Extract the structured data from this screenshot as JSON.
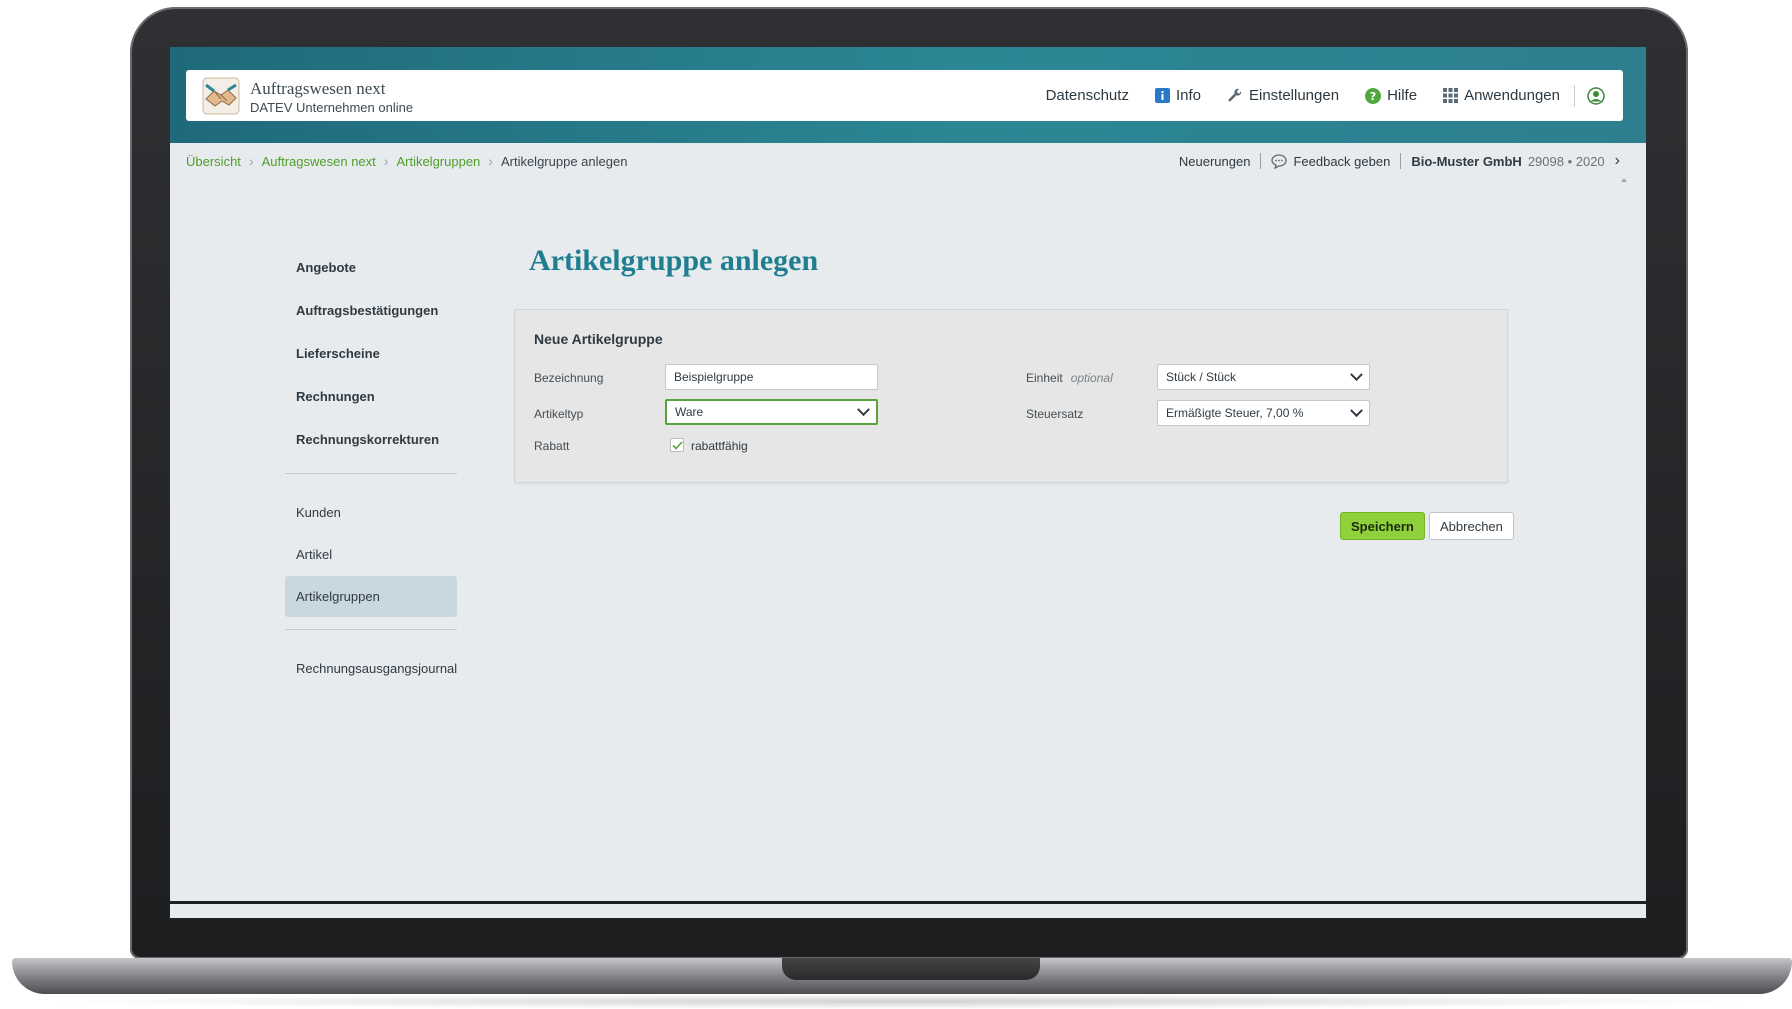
{
  "app": {
    "title": "Auftragswesen next",
    "subtitle": "DATEV Unternehmen online"
  },
  "header_nav": {
    "datenschutz": "Datenschutz",
    "info": "Info",
    "einstellungen": "Einstellungen",
    "hilfe": "Hilfe",
    "anwendungen": "Anwendungen"
  },
  "breadcrumb": {
    "items": [
      "Übersicht",
      "Auftragswesen next",
      "Artikelgruppen"
    ],
    "current": "Artikelgruppe anlegen"
  },
  "topbar_right": {
    "neuerungen": "Neuerungen",
    "feedback": "Feedback geben",
    "org_name": "Bio-Muster GmbH",
    "org_meta": "29098 • 2020"
  },
  "sidebar": {
    "primary": [
      "Angebote",
      "Auftragsbestätigungen",
      "Lieferscheine",
      "Rechnungen",
      "Rechnungskorrekturen"
    ],
    "secondary": [
      "Kunden",
      "Artikel",
      "Artikelgruppen"
    ],
    "active": "Artikelgruppen",
    "tertiary": [
      "Rechnungsausgangsjournal"
    ]
  },
  "page": {
    "title": "Artikelgruppe anlegen"
  },
  "form": {
    "panel_title": "Neue Artikelgruppe",
    "bezeichnung_label": "Bezeichnung",
    "bezeichnung_value": "Beispielgruppe",
    "artikeltyp_label": "Artikeltyp",
    "artikeltyp_value": "Ware",
    "rabatt_label": "Rabatt",
    "rabatt_checkbox_label": "rabattfähig",
    "rabatt_checked": true,
    "einheit_label": "Einheit",
    "einheit_optional": "optional",
    "einheit_value": "Stück / Stück",
    "steuersatz_label": "Steuersatz",
    "steuersatz_value": "Ermäßigte Steuer, 7,00 %"
  },
  "actions": {
    "save": "Speichern",
    "cancel": "Abbrechen"
  },
  "colors": {
    "brand_teal": "#1f7f90",
    "link_green": "#4f9e2c",
    "primary_button": "#8fd13a"
  }
}
